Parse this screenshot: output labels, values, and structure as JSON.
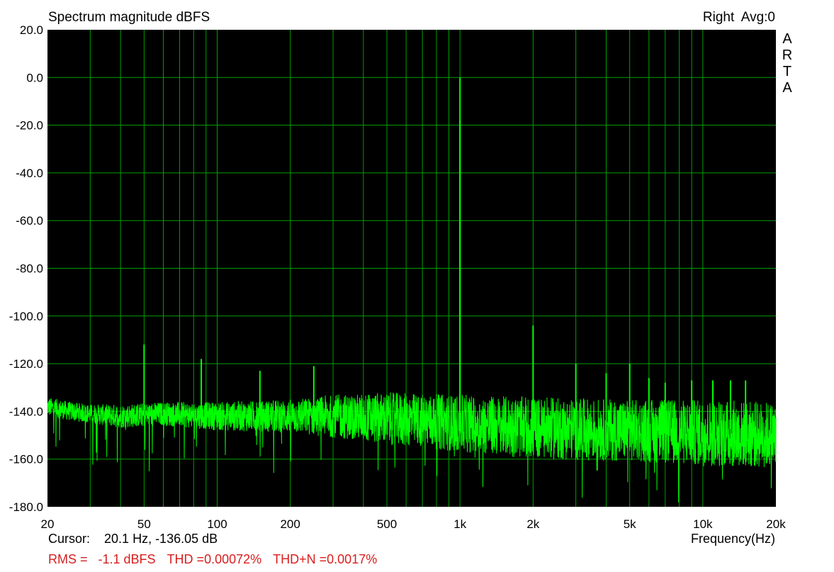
{
  "header": {
    "title": "Spectrum magnitude dBFS",
    "channel": "Right",
    "avg": "Avg:0"
  },
  "brand_letters": [
    "A",
    "R",
    "T",
    "A"
  ],
  "footer": {
    "cursor_label": "Cursor:",
    "cursor_value": "20.1 Hz, -136.05 dB",
    "xlabel": "Frequency(Hz)",
    "rms": "RMS =   -1.1 dBFS",
    "thd": "THD =0.00072%",
    "thdn": "THD+N =0.0017%"
  },
  "colors": {
    "plot_background": "#000000",
    "grid": "#00a000",
    "trace": "#00ff00",
    "stats_text": "#d81e1e"
  },
  "chart_data": {
    "type": "line",
    "title": "Spectrum magnitude dBFS",
    "xlabel": "Frequency(Hz)",
    "ylabel": "",
    "xscale": "log",
    "xlim": [
      20,
      20000
    ],
    "ylim": [
      -180,
      20
    ],
    "grid": true,
    "yticks": [
      20,
      0,
      -20,
      -40,
      -60,
      -80,
      -100,
      -120,
      -140,
      -160,
      -180
    ],
    "ytick_labels": [
      "20.0",
      "0.0",
      "-20.0",
      "-40.0",
      "-60.0",
      "-80.0",
      "-100.0",
      "-120.0",
      "-140.0",
      "-160.0",
      "-180.0"
    ],
    "xticks": [
      20,
      50,
      100,
      200,
      500,
      1000,
      2000,
      5000,
      10000,
      20000
    ],
    "xtick_labels": [
      "20",
      "50",
      "100",
      "200",
      "500",
      "1k",
      "2k",
      "5k",
      "10k",
      "20k"
    ],
    "noise_floor": {
      "x": [
        20,
        25,
        30,
        40,
        60,
        100,
        200,
        300,
        500,
        1000,
        2000,
        5000,
        10000,
        20000
      ],
      "center_db": [
        -138,
        -140,
        -141,
        -142,
        -141,
        -142,
        -142,
        -142,
        -143,
        -145,
        -147,
        -148,
        -149,
        -150
      ],
      "band_db": [
        4,
        4,
        4,
        5,
        5,
        6,
        7,
        9,
        11,
        12,
        13,
        13,
        14,
        14
      ]
    },
    "peaks": [
      {
        "x": 50,
        "y": -112
      },
      {
        "x": 86,
        "y": -118
      },
      {
        "x": 150,
        "y": -123
      },
      {
        "x": 250,
        "y": -121
      },
      {
        "x": 1000,
        "y": 0
      },
      {
        "x": 1000,
        "y": -18
      },
      {
        "x": 2000,
        "y": -104
      },
      {
        "x": 3000,
        "y": -120
      },
      {
        "x": 4000,
        "y": -124
      },
      {
        "x": 5000,
        "y": -120
      },
      {
        "x": 6000,
        "y": -126
      },
      {
        "x": 7000,
        "y": -128
      },
      {
        "x": 9000,
        "y": -127
      },
      {
        "x": 11000,
        "y": -127
      },
      {
        "x": 13000,
        "y": -127
      },
      {
        "x": 15000,
        "y": -127
      }
    ]
  }
}
